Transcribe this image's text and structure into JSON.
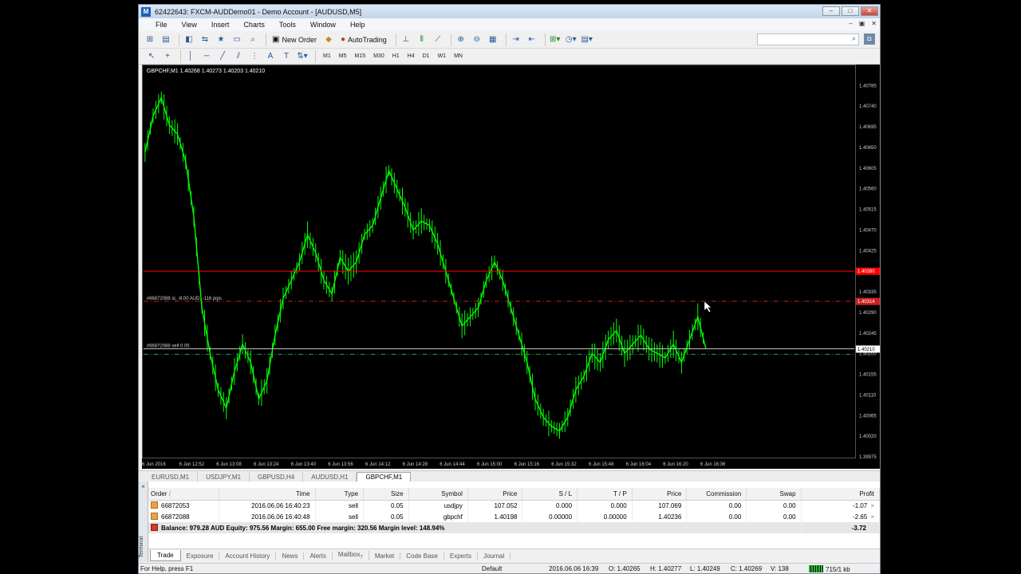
{
  "window": {
    "title": "62422643: FXCM-AUDDemo01 - Demo Account - [AUDUSD,M5]",
    "app_icon": "metatrader-icon",
    "buttons": {
      "minimize": "–",
      "maximize": "□",
      "close": "✕"
    },
    "child_buttons": {
      "minimize": "–",
      "restore": "▣",
      "close": "✕"
    }
  },
  "menu": [
    "File",
    "View",
    "Insert",
    "Charts",
    "Tools",
    "Window",
    "Help"
  ],
  "toolbar": {
    "new_order": "New Order",
    "auto_trading": "AutoTrading"
  },
  "timeframes": [
    "M1",
    "M5",
    "M15",
    "M30",
    "H1",
    "H4",
    "D1",
    "W1",
    "MN"
  ],
  "chart": {
    "header": "GBPCHF,M1  1.40268 1.40273 1.40203 1.40210",
    "sl_label": "#66872088 sl, -8.00 AUD, -116 pips",
    "order_label": "#66872088 sell 0.05",
    "line_red_price": "1.40380",
    "line_sl_price": "1.40314",
    "line_bid_price": "1.40210",
    "colors": {
      "candles": "#00ff00",
      "red_line": "#ff0000",
      "sl_line": "#cc2020",
      "entry_line": "#1f9d55",
      "bid_line": "#c0c0c0"
    }
  },
  "chart_data": {
    "type": "line",
    "title": "",
    "xlabel": "",
    "ylabel": "",
    "symbol": "GBPCHF",
    "timeframe": "M1",
    "ylim": [
      1.39975,
      1.4081
    ],
    "y_ticks": [
      "1.40785",
      "1.40740",
      "1.40695",
      "1.40650",
      "1.40605",
      "1.40560",
      "1.40515",
      "1.40470",
      "1.40425",
      "1.40380",
      "1.40335",
      "1.40290",
      "1.40245",
      "1.40200",
      "1.40155",
      "1.40110",
      "1.40065",
      "1.40020",
      "1.39975"
    ],
    "x_ticks": [
      "6 Jun 2016",
      "6 Jun 12:52",
      "6 Jun 13:08",
      "6 Jun 13:24",
      "6 Jun 13:40",
      "6 Jun 13:56",
      "6 Jun 14:12",
      "6 Jun 14:28",
      "6 Jun 14:44",
      "6 Jun 15:00",
      "6 Jun 15:16",
      "6 Jun 15:32",
      "6 Jun 15:48",
      "6 Jun 16:04",
      "6 Jun 16:20",
      "6 Jun 16:36"
    ],
    "series": [
      {
        "values": [
          1.4064,
          1.4072,
          1.4076,
          1.407,
          1.4068,
          1.4062,
          1.405,
          1.403,
          1.402,
          1.4012,
          1.4008,
          1.4016,
          1.4022,
          1.4018,
          1.401,
          1.4014,
          1.4024,
          1.4032,
          1.4036,
          1.404,
          1.4046,
          1.4042,
          1.4036,
          1.4033,
          1.4041,
          1.4038,
          1.404,
          1.4046,
          1.4048,
          1.4054,
          1.406,
          1.4056,
          1.4052,
          1.4047,
          1.4049,
          1.4048,
          1.4044,
          1.4038,
          1.4032,
          1.4026,
          1.4028,
          1.403,
          1.4036,
          1.404,
          1.4036,
          1.403,
          1.4024,
          1.4018,
          1.401,
          1.4006,
          1.4004,
          1.4003,
          1.4006,
          1.4012,
          1.4015,
          1.402,
          1.4018,
          1.4023,
          1.4025,
          1.402,
          1.4022,
          1.4024,
          1.4021,
          1.402,
          1.4019,
          1.4022,
          1.4018,
          1.4023,
          1.4028,
          1.4021
        ]
      }
    ]
  },
  "chart_tabs": [
    "EURUSD,M1",
    "USDJPY,M1",
    "GBPUSD,H4",
    "AUDUSD,H1",
    "GBPCHF,M1"
  ],
  "chart_tabs_active": 4,
  "trade_table": {
    "headers": [
      "Order",
      "/",
      "Time",
      "Type",
      "Size",
      "Symbol",
      "Price",
      "S / L",
      "T / P",
      "Price",
      "Commission",
      "Swap",
      "Profit"
    ],
    "rows": [
      {
        "order": "66872053",
        "time": "2016.06.06 16:40:23",
        "type": "sell",
        "size": "0.05",
        "symbol": "usdjpy",
        "price": "107.052",
        "sl": "0.000",
        "tp": "0.000",
        "cur_price": "107.069",
        "commission": "0.00",
        "swap": "0.00",
        "profit": "-1.07",
        "close": "×"
      },
      {
        "order": "66872088",
        "time": "2016.06.06 16:40:48",
        "type": "sell",
        "size": "0.05",
        "symbol": "gbpchf",
        "price": "1.40198",
        "sl": "0.00000",
        "tp": "0.00000",
        "cur_price": "1.40236",
        "commission": "0.00",
        "swap": "0.00",
        "profit": "-2.65",
        "close": "×"
      }
    ],
    "balance_line": "Balance: 979.28 AUD  Equity: 975.56  Margin: 655.00  Free margin: 320.56  Margin level: 148.94%",
    "balance_profit": "-3.72"
  },
  "terminal": {
    "side_label": "Terminal",
    "close": "×",
    "tabs": [
      "Trade",
      "Exposure",
      "Account History",
      "News",
      "Alerts",
      "Mailbox",
      "Market",
      "Code Base",
      "Experts",
      "Journal"
    ],
    "mailbox_badge": "7"
  },
  "statusbar": {
    "help": "For Help, press F1",
    "profile": "Default",
    "datetime": "2016.06.06 16:39",
    "open": "O: 1.40265",
    "high": "H: 1.40277",
    "low": "L: 1.40249",
    "close": "C: 1.40269",
    "volume": "V: 138",
    "traffic": "715/1 kb"
  }
}
